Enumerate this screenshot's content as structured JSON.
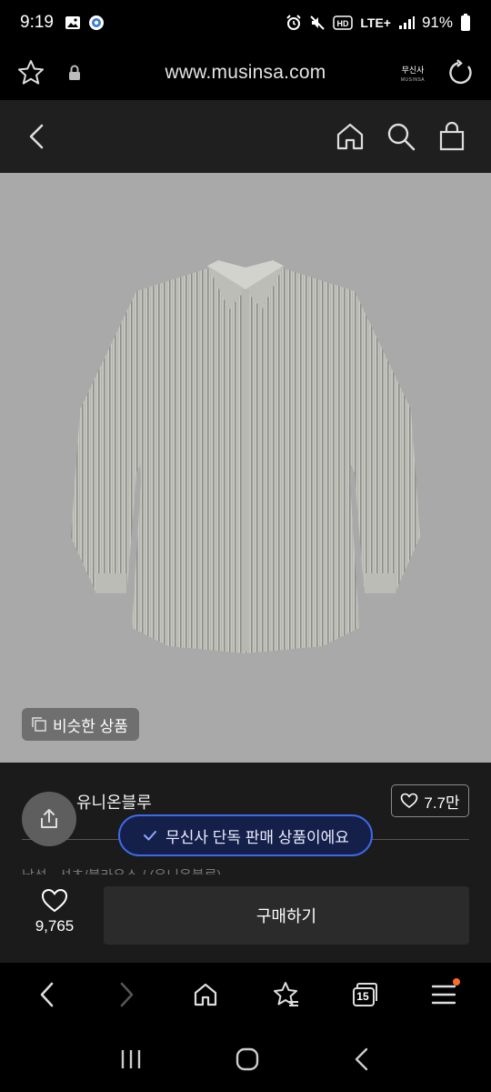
{
  "status_bar": {
    "time": "9:19",
    "network": "LTE+",
    "battery": "91%",
    "icons": [
      "image-icon",
      "app-icon",
      "alarm-icon",
      "mute-icon",
      "hd-icon",
      "signal-icon",
      "battery-icon"
    ]
  },
  "browser": {
    "url": "www.musinsa.com",
    "logo_text": "무신사",
    "logo_sub": "MUSINSA"
  },
  "product": {
    "similar_label": "비슷한 상품",
    "brand": "유니온블루",
    "likes": "7.7만",
    "partial_line": "남성 · 셔츠/블라우스 / (유니온블루)"
  },
  "toast": {
    "text": "무신사 단독 판매 상품이에요",
    "accent": "#3d6ae8"
  },
  "action_bar": {
    "wish_count": "9,765",
    "buy_label": "구매하기"
  },
  "browser_nav": {
    "tabs_count": "15"
  },
  "colors": {
    "background": "#000000",
    "header": "#1f1f1f",
    "image_bg": "#a9a9a9",
    "notification_dot": "#ff6a2a"
  }
}
